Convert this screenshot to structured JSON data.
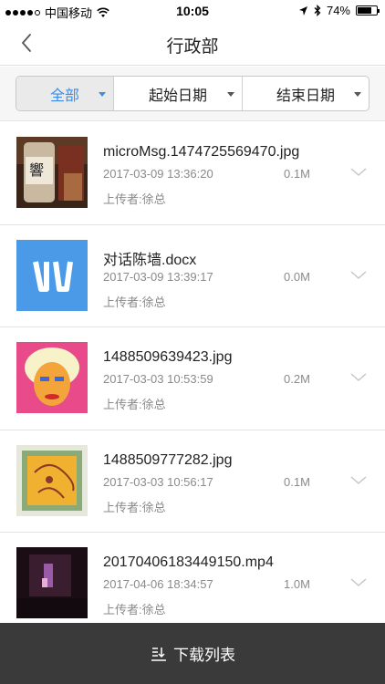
{
  "status_bar": {
    "carrier": "中国移动",
    "time": "10:05",
    "battery": "74%",
    "battery_level": 0.74
  },
  "nav": {
    "title": "行政部"
  },
  "filters": {
    "all_label": "全部",
    "start_date_label": "起始日期",
    "end_date_label": "结束日期"
  },
  "files": [
    {
      "name": "microMsg.1474725569470.jpg",
      "date": "2017-03-09 13:36:20",
      "size": "0.1M",
      "uploader": "上传者:徐总",
      "thumb": "photo-whisky"
    },
    {
      "name": "对话陈墙.docx",
      "date": "2017-03-09 13:39:17",
      "size": "0.0M",
      "uploader": "上传者:徐总",
      "thumb": "word-doc-icon"
    },
    {
      "name": "1488509639423.jpg",
      "date": "2017-03-03 10:53:59",
      "size": "0.2M",
      "uploader": "上传者:徐总",
      "thumb": "photo-popart-portrait"
    },
    {
      "name": "1488509777282.jpg",
      "date": "2017-03-03 10:56:17",
      "size": "0.1M",
      "uploader": "上传者:徐总",
      "thumb": "photo-yellow-painting"
    },
    {
      "name": "20170406183449150.mp4",
      "date": "2017-04-06 18:34:57",
      "size": "1.0M",
      "uploader": "上传者:徐总",
      "thumb": "video-dark-frame"
    }
  ],
  "bottom_bar": {
    "download_label": "下载列表"
  },
  "colors": {
    "accent_blue": "#3a8ee6",
    "bottom_bar_bg": "#3a3a3a",
    "doc_icon_blue": "#4a9ae8"
  }
}
